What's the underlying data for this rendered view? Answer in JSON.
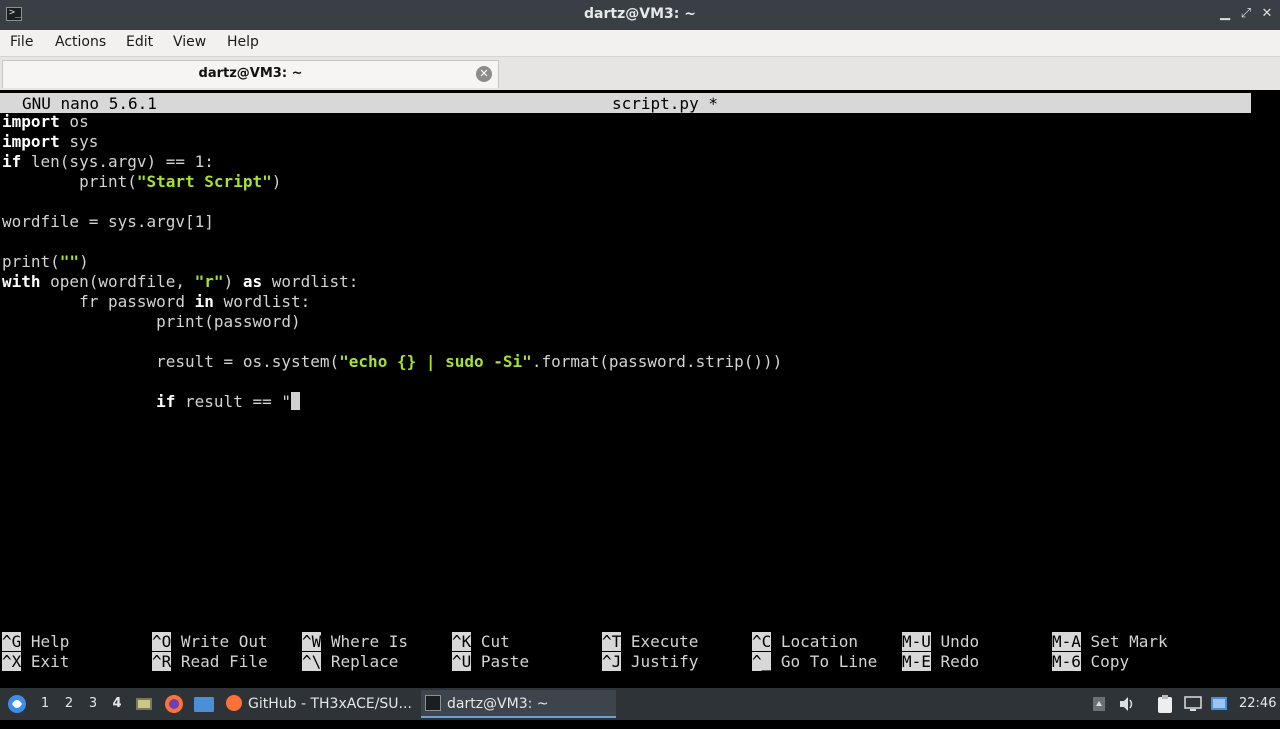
{
  "window": {
    "title": "dartz@VM3: ~",
    "minimize": "▁",
    "maximize": "⤢",
    "close": "✕"
  },
  "menubar": {
    "items": [
      "File",
      "Actions",
      "Edit",
      "View",
      "Help"
    ]
  },
  "tab": {
    "label": "dartz@VM3: ~",
    "close_glyph": "✕"
  },
  "nano": {
    "version": "GNU nano 5.6.1",
    "filename": "script.py *",
    "lines": [
      [
        [
          "kw",
          "import"
        ],
        [
          "t",
          " os"
        ]
      ],
      [
        [
          "kw",
          "import"
        ],
        [
          "t",
          " sys"
        ]
      ],
      [
        [
          "kw",
          "if"
        ],
        [
          "t",
          " len(sys.argv) == 1:"
        ]
      ],
      [
        [
          "t",
          "        print("
        ],
        [
          "str",
          "\"Start Script\""
        ],
        [
          "t",
          ")"
        ]
      ],
      [],
      [
        [
          "t",
          "wordfile = sys.argv[1]"
        ]
      ],
      [],
      [
        [
          "t",
          "print("
        ],
        [
          "str",
          "\"\""
        ],
        [
          "t",
          ")"
        ]
      ],
      [
        [
          "kw",
          "with"
        ],
        [
          "t",
          " open(wordfile, "
        ],
        [
          "str",
          "\"r\""
        ],
        [
          "t",
          ") "
        ],
        [
          "kw",
          "as"
        ],
        [
          "t",
          " wordlist:"
        ]
      ],
      [
        [
          "t",
          "        fr password "
        ],
        [
          "kw",
          "in"
        ],
        [
          "t",
          " wordlist:"
        ]
      ],
      [
        [
          "t",
          "                print(password)"
        ]
      ],
      [],
      [
        [
          "t",
          "                result = os.system("
        ],
        [
          "str",
          "\"echo {} | sudo -Si\""
        ],
        [
          "t",
          ".format(password.strip()))"
        ]
      ],
      [],
      [
        [
          "t",
          "                "
        ],
        [
          "kw",
          "if"
        ],
        [
          "t",
          " result == \""
        ],
        [
          "cursor",
          ""
        ]
      ]
    ],
    "shortcuts": [
      [
        {
          "key": "^G",
          "desc": "Help"
        },
        {
          "key": "^X",
          "desc": "Exit"
        }
      ],
      [
        {
          "key": "^O",
          "desc": "Write Out"
        },
        {
          "key": "^R",
          "desc": "Read File"
        }
      ],
      [
        {
          "key": "^W",
          "desc": "Where Is"
        },
        {
          "key": "^\\",
          "desc": "Replace"
        }
      ],
      [
        {
          "key": "^K",
          "desc": "Cut"
        },
        {
          "key": "^U",
          "desc": "Paste"
        }
      ],
      [
        {
          "key": "^T",
          "desc": "Execute"
        },
        {
          "key": "^J",
          "desc": "Justify"
        }
      ],
      [
        {
          "key": "^C",
          "desc": "Location"
        },
        {
          "key": "^_",
          "desc": "Go To Line"
        }
      ],
      [
        {
          "key": "M-U",
          "desc": "Undo"
        },
        {
          "key": "M-E",
          "desc": "Redo"
        }
      ],
      [
        {
          "key": "M-A",
          "desc": "Set Mark"
        },
        {
          "key": "M-6",
          "desc": "Copy"
        }
      ]
    ]
  },
  "taskbar": {
    "workspaces": [
      "1",
      "2",
      "3",
      "4"
    ],
    "active_workspace": "4",
    "tasks": [
      {
        "label": "GitHub - TH3xACE/SU...",
        "icon": "firefox-icon"
      },
      {
        "label": "dartz@VM3: ~",
        "icon": "terminal-icon"
      }
    ],
    "clock": "22:46",
    "colors": {
      "firefox": "#ff7139",
      "folder": "#4a90d9",
      "taskbar_bg": "#2e3338"
    }
  }
}
